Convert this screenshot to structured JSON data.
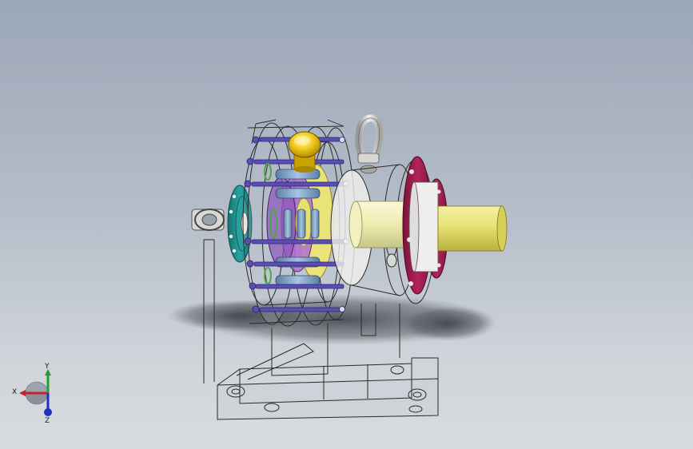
{
  "triad": {
    "x_label": "X",
    "y_label": "Y",
    "z_label": "Z"
  },
  "colors": {
    "background_top": "#9ba6b7",
    "background_bottom": "#d8dcdf",
    "teal_flange": "#1f8f8f",
    "crimson_flange": "#9a1d4e",
    "output_shaft": "#e6e070",
    "input_cap": "#e0b800",
    "bolts": "#5a4fb0",
    "wireframe": "#2a2a2a",
    "x_axis": "#c8202a",
    "y_axis": "#2a9b2a",
    "z_axis": "#2030c0"
  }
}
